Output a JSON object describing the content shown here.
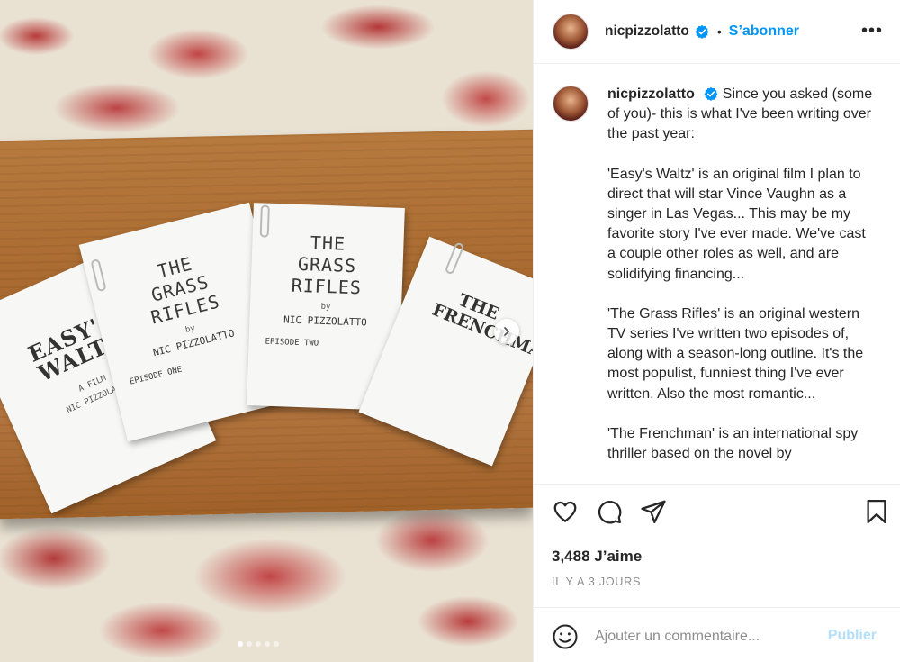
{
  "post": {
    "username": "nicpizzolatto",
    "follow_label": "S’abonner",
    "separator": "•",
    "more_label": "•••",
    "caption": [
      "Since you asked (some of you)- this is what I've been writing over the past year:",
      "'Easy's Waltz' is an original film I plan to direct that will star Vince Vaughn as a singer in Las Vegas... This may be my favorite story I've ever made. We've cast a couple other roles as well, and are solidifying financing...",
      "'The Grass Rifles' is an original western TV series I've written two episodes of, along with a season-long outline. It's the most populist, funniest thing I've ever written. Also the most romantic...",
      "'The Frenchman' is an international spy thriller based on the novel by"
    ],
    "likes": "3,488 J’aime",
    "time": "IL Y A 3 JOURS",
    "comment_placeholder": "Ajouter un commentaire...",
    "publish_label": "Publier",
    "accent_color": "#0095f6"
  },
  "photo": {
    "papers": {
      "easys_waltz": {
        "title": "EASY'S WALTZ",
        "line1": "A FILM",
        "line2": "NIC PIZZOLATTO"
      },
      "grass_rifles_1": {
        "title": "THE GRASS RIFLES",
        "by": "by",
        "author": "NIC PIZZOLATTO",
        "episode": "EPISODE ONE"
      },
      "grass_rifles_2": {
        "title": "THE GRASS RIFLES",
        "by": "by",
        "author": "NIC PIZZOLATTO",
        "episode": "EPISODE TWO"
      },
      "frenchman": {
        "title": "THE FRENCHMAN"
      }
    },
    "carousel_total": 5,
    "carousel_active": 1
  }
}
